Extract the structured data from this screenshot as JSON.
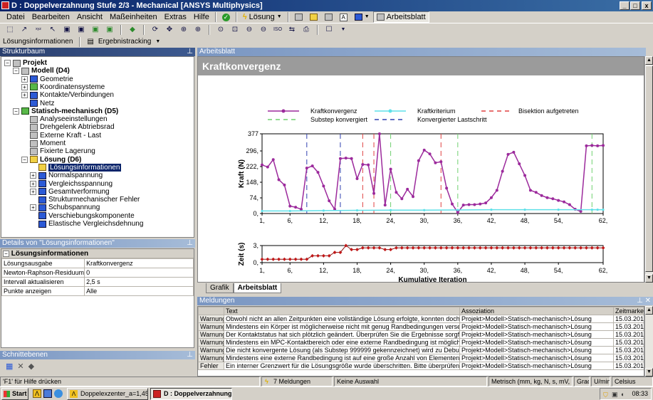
{
  "window": {
    "title": "D : Doppelverzahnung Stufe 2/3 - Mechanical [ANSYS Multiphysics]",
    "min": "_",
    "max": "□",
    "close": "x"
  },
  "menu": {
    "items": [
      "Datei",
      "Bearbeiten",
      "Ansicht",
      "Maßeinheiten",
      "Extras",
      "Hilfe"
    ],
    "solve_label": "Lösung",
    "worksheet_label": "Arbeitsblatt"
  },
  "toolbar3": {
    "loesungsinfo": "Lösungsinformationen",
    "ergebnistracking": "Ergebnistracking"
  },
  "tree_panel": {
    "title": "Strukturbaum",
    "items": [
      {
        "label": "Projekt",
        "bold": true
      },
      {
        "label": "Modell (D4)",
        "bold": true
      },
      {
        "label": "Geometrie"
      },
      {
        "label": "Koordinatensysteme"
      },
      {
        "label": "Kontakte/Verbindungen"
      },
      {
        "label": "Netz"
      },
      {
        "label": "Statisch-mechanisch (D5)",
        "bold": true
      },
      {
        "label": "Analyseeinstellungen"
      },
      {
        "label": "Drehgelenk Abtriebsrad"
      },
      {
        "label": "Externe Kraft - Last"
      },
      {
        "label": "Moment"
      },
      {
        "label": "Fixierte Lagerung"
      },
      {
        "label": "Lösung (D6)",
        "bold": true
      },
      {
        "label": "Lösungsinformationen",
        "selected": true
      },
      {
        "label": "Normalspannung"
      },
      {
        "label": "Vergleichsspannung"
      },
      {
        "label": "Gesamtverformung"
      },
      {
        "label": "Strukturmechanischer Fehler"
      },
      {
        "label": "Schubspannung"
      },
      {
        "label": "Verschiebungskomponente"
      },
      {
        "label": "Elastische Vergleichsdehnung"
      }
    ]
  },
  "details_panel": {
    "title": "Details von \"Lösungsinformationen\"",
    "section": "Lösungsinformationen",
    "rows": [
      {
        "key": "Lösungsausgabe",
        "value": "Kraftkonvergenz"
      },
      {
        "key": "Newton-Raphson-Residuum",
        "value": "0"
      },
      {
        "key": "Intervall aktualisieren",
        "value": "2,5 s"
      },
      {
        "key": "Punkte anzeigen",
        "value": "Alle"
      }
    ]
  },
  "section_panel": {
    "title": "Schnittebenen"
  },
  "worksheet": {
    "header": "Arbeitsblatt",
    "title": "Kraftkonvergenz",
    "tabs": [
      "Grafik",
      "Arbeitsblatt"
    ],
    "active_tab": 1
  },
  "chart_data": [
    {
      "type": "line",
      "title": "",
      "xlabel": "",
      "ylabel": "Kraft (N)",
      "ylim": [
        0,
        377
      ],
      "xlim": [
        1,
        62
      ],
      "x_ticks": [
        "1,",
        "6,",
        "12,",
        "18,",
        "24,",
        "30,",
        "36,",
        "42,",
        "48,",
        "54,",
        "62,"
      ],
      "y_ticks": [
        "0,",
        "74,",
        "148,",
        "222,",
        "296,",
        "377"
      ],
      "legend": [
        {
          "name": "Kraftkonvergenz",
          "color": "#9c2a9c",
          "style": "line-marker"
        },
        {
          "name": "Kraftkriterium",
          "color": "#5fe0e8",
          "style": "line-marker"
        },
        {
          "name": "Bisektion aufgetreten",
          "color": "#e04040",
          "style": "dash"
        },
        {
          "name": "Substep konvergiert",
          "color": "#6fd06f",
          "style": "dash"
        },
        {
          "name": "Konvergierter Lastschritt",
          "color": "#3040b0",
          "style": "dash"
        }
      ],
      "series": [
        {
          "name": "Kraftkonvergenz",
          "x": [
            1,
            2,
            3,
            4,
            5,
            6,
            7,
            8,
            9,
            10,
            11,
            12,
            13,
            14,
            15,
            16,
            17,
            18,
            19,
            20,
            21,
            22,
            23,
            24,
            25,
            26,
            27,
            28,
            29,
            30,
            31,
            32,
            33,
            34,
            35,
            36,
            37,
            38,
            39,
            40,
            41,
            42,
            43,
            44,
            45,
            46,
            47,
            48,
            49,
            50,
            51,
            52,
            53,
            54,
            55,
            56,
            57,
            58,
            59,
            60,
            61,
            62
          ],
          "y": [
            230,
            220,
            255,
            160,
            135,
            35,
            30,
            20,
            215,
            225,
            195,
            130,
            60,
            20,
            260,
            262,
            260,
            165,
            232,
            230,
            95,
            377,
            40,
            210,
            100,
            70,
            115,
            80,
            250,
            300,
            282,
            240,
            245,
            120,
            45,
            5,
            40,
            42,
            42,
            45,
            50,
            75,
            110,
            200,
            280,
            290,
            235,
            180,
            110,
            100,
            85,
            75,
            70,
            62,
            55,
            42,
            20,
            10,
            320,
            322,
            320,
            322
          ]
        },
        {
          "name": "Kraftkriterium",
          "x": [
            1,
            6,
            12,
            18,
            24,
            30,
            36,
            42,
            48,
            54,
            60,
            61,
            62
          ],
          "y": [
            12,
            12,
            14,
            15,
            16,
            16,
            17,
            18,
            18,
            18,
            18,
            18,
            18
          ]
        }
      ],
      "vlines": [
        {
          "x": 9,
          "kind": "Konvergierter Lastschritt"
        },
        {
          "x": 15,
          "kind": "Konvergierter Lastschritt"
        },
        {
          "x": 19,
          "kind": "Bisektion aufgetreten"
        },
        {
          "x": 21,
          "kind": "Bisektion aufgetreten"
        },
        {
          "x": 24,
          "kind": "Substep konvergiert"
        },
        {
          "x": 33,
          "kind": "Bisektion aufgetreten"
        },
        {
          "x": 36,
          "kind": "Substep konvergiert"
        },
        {
          "x": 60,
          "kind": "Substep konvergiert"
        }
      ]
    },
    {
      "type": "line",
      "title": "",
      "xlabel": "Kumulative Iteration",
      "ylabel": "Zeit (s)",
      "ylim": [
        0,
        3
      ],
      "xlim": [
        1,
        62
      ],
      "x_ticks": [
        "1,",
        "6,",
        "12,",
        "18,",
        "24,",
        "30,",
        "36,",
        "42,",
        "48,",
        "54,",
        "62,"
      ],
      "y_ticks": [
        "0,",
        "3,"
      ],
      "series": [
        {
          "name": "Zeit",
          "x": [
            1,
            2,
            3,
            4,
            5,
            6,
            7,
            8,
            9,
            10,
            11,
            12,
            13,
            14,
            15,
            16,
            17,
            18,
            19,
            20,
            21,
            22,
            23,
            24,
            25,
            26,
            27,
            28,
            29,
            30,
            31,
            32,
            33,
            34,
            35,
            36,
            37,
            38,
            39,
            40,
            41,
            42,
            43,
            44,
            45,
            46,
            47,
            48,
            49,
            50,
            51,
            52,
            53,
            54,
            55,
            56,
            57,
            58,
            59,
            60,
            61,
            62
          ],
          "y": [
            0.6,
            0.6,
            0.6,
            0.6,
            0.6,
            0.6,
            0.6,
            0.6,
            0.6,
            1.2,
            1.2,
            1.2,
            1.2,
            1.8,
            1.8,
            3.0,
            2.3,
            2.3,
            2.6,
            2.6,
            2.6,
            2.6,
            2.3,
            2.3,
            2.6,
            2.6,
            2.6,
            2.6,
            2.6,
            2.6,
            2.6,
            2.6,
            2.6,
            2.6,
            2.6,
            2.6,
            2.6,
            2.6,
            2.6,
            2.6,
            2.6,
            2.6,
            2.6,
            2.6,
            2.6,
            2.6,
            2.6,
            2.6,
            2.6,
            2.6,
            2.6,
            2.6,
            2.6,
            2.6,
            2.6,
            2.6,
            2.6,
            2.6,
            2.6,
            2.6,
            2.6,
            2.6
          ]
        }
      ]
    }
  ],
  "messages": {
    "title": "Meldungen",
    "columns": [
      "",
      "Text",
      "Assoziation",
      "Zeitmarke"
    ],
    "rows": [
      {
        "type": "Warnung",
        "text": "Obwohl nicht an allen Zeitpunkten eine vollständige Lösung erfolgte, konnten doch an einigen Pu",
        "assoc": "Projekt>Modell>Statisch-mechanisch>Lösung",
        "time": "15.03.2011"
      },
      {
        "type": "Warnung",
        "text": "Mindestens ein Körper ist möglicherweise nicht mit genug Randbedingungen versehen, so dass s",
        "assoc": "Projekt>Modell>Statisch-mechanisch>Lösung",
        "time": "15.03.2011"
      },
      {
        "type": "Warnung",
        "text": "Der Kontaktstatus hat sich plötzlich geändert.  Überprüfen Sie die Ergebnisse sorgfältig auf eine",
        "assoc": "Projekt>Modell>Statisch-mechanisch>Lösung",
        "time": "15.03.2011"
      },
      {
        "type": "Warnung",
        "text": "Mindestens ein MPC-Kontaktbereich oder eine externe Randbedingung ist möglicherweise in K",
        "assoc": "Projekt>Modell>Statisch-mechanisch>Lösung",
        "time": "15.03.2011"
      },
      {
        "type": "Warnung",
        "text": "Die nicht konvergente Lösung (als Substep 999999 gekennzeichnet) wird zu Debugging-Zwecke",
        "assoc": "Projekt>Modell>Statisch-mechanisch>Lösung",
        "time": "15.03.2011"
      },
      {
        "type": "Warnung",
        "text": "Mindestens eine externe Randbedingung ist auf eine große Anzahl von Elementen begrenzt, wa",
        "assoc": "Projekt>Modell>Statisch-mechanisch>Lösung",
        "time": "15.03.2011"
      },
      {
        "type": "Fehler",
        "text": "Ein interner Grenzwert für die Lösungsgröße wurde überschritten. Bitte überprüfen Sie Ihre Umg",
        "assoc": "Projekt>Modell>Statisch-mechanisch>Lösung",
        "time": "15.03.2011"
      }
    ]
  },
  "status": {
    "help": "'F1' für Hilfe drücken",
    "messages": "7 Meldungen",
    "selection": "Keine Auswahl",
    "units": "Metrisch (mm, kg, N, s, mV, mA)",
    "angle": "Grad",
    "speed": "U/min",
    "temp": "Celsius"
  },
  "taskbar": {
    "start": "Start",
    "tasks": [
      "Doppelexzenter_a=1,45....",
      "D : Doppelverzahnung..."
    ],
    "clock": "08:33"
  }
}
